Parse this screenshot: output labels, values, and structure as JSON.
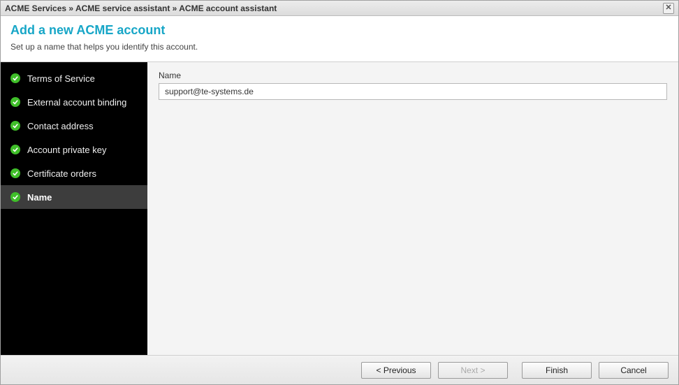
{
  "titlebar": {
    "breadcrumb": "ACME Services » ACME service assistant » ACME account assistant"
  },
  "header": {
    "title": "Add a new ACME account",
    "subtitle": "Set up a name that helps you identify this account."
  },
  "sidebar": {
    "steps": [
      {
        "label": "Terms of Service",
        "complete": true,
        "active": false
      },
      {
        "label": "External account binding",
        "complete": true,
        "active": false
      },
      {
        "label": "Contact address",
        "complete": true,
        "active": false
      },
      {
        "label": "Account private key",
        "complete": true,
        "active": false
      },
      {
        "label": "Certificate orders",
        "complete": true,
        "active": false
      },
      {
        "label": "Name",
        "complete": true,
        "active": true
      }
    ]
  },
  "form": {
    "name_label": "Name",
    "name_value": "support@te-systems.de"
  },
  "footer": {
    "previous": "< Previous",
    "next": "Next >",
    "finish": "Finish",
    "cancel": "Cancel"
  }
}
